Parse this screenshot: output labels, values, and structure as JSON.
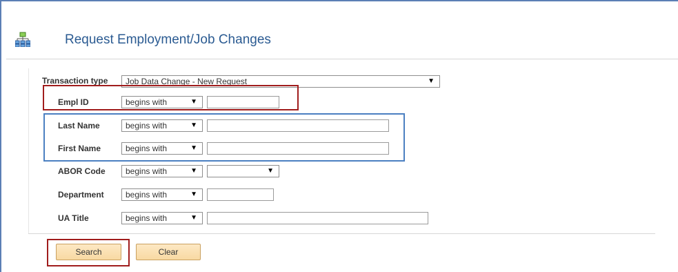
{
  "page": {
    "title": "Request Employment/Job Changes"
  },
  "form": {
    "transaction_type": {
      "label": "Transaction type",
      "value": "Job Data Change - New Request"
    },
    "empl_id": {
      "label": "Empl ID",
      "operator": "begins with",
      "value": ""
    },
    "last_name": {
      "label": "Last Name",
      "operator": "begins with",
      "value": ""
    },
    "first_name": {
      "label": "First Name",
      "operator": "begins with",
      "value": ""
    },
    "abor_code": {
      "label": "ABOR Code",
      "operator": "begins with",
      "value": ""
    },
    "department": {
      "label": "Department",
      "operator": "begins with",
      "value": ""
    },
    "ua_title": {
      "label": "UA Title",
      "operator": "begins with",
      "value": ""
    }
  },
  "buttons": {
    "search": "Search",
    "clear": "Clear"
  },
  "colors": {
    "title": "#2b5b92",
    "highlight_red": "#a01c1c",
    "highlight_blue": "#4a7fc1",
    "button_bg": "#fbe3b6"
  },
  "icons": {
    "app": "org-chart-icon",
    "dropdown": "caret-down-icon"
  }
}
